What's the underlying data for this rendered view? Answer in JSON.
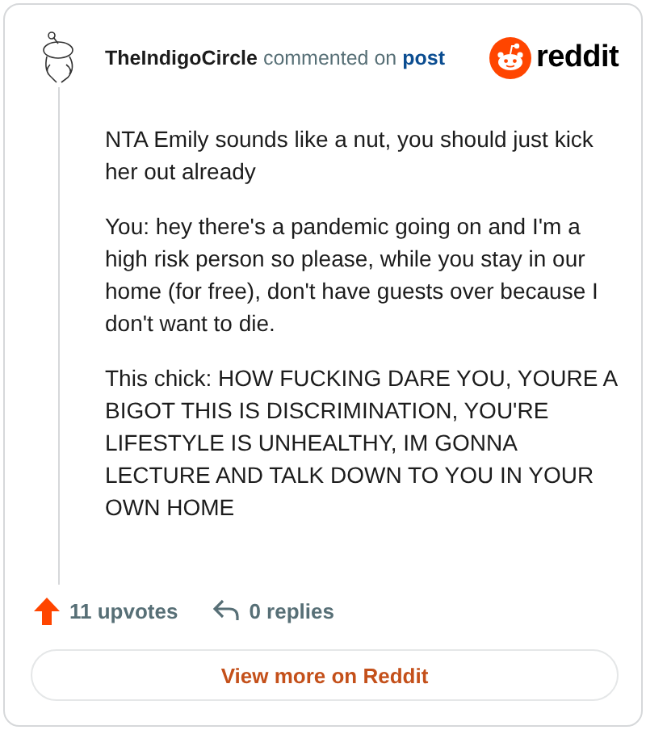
{
  "comment": {
    "author": "TheIndigoCircle",
    "action": "commented on",
    "link": "post"
  },
  "logo": {
    "wordmark": "reddit"
  },
  "paragraphs": [
    "NTA Emily sounds like a nut, you should just kick her out already",
    "You: hey there's a pandemic going on and I'm a high risk person so please, while you stay in our home (for free), don't have guests over because I don't want to die.",
    "This chick: HOW FUCKING DARE YOU, YOURE A BIGOT THIS IS DISCRIMINATION, YOU'RE LIFESTYLE IS UNHEALTHY, IM GONNA LECTURE AND TALK DOWN TO YOU IN YOUR OWN HOME"
  ],
  "stats": {
    "upvotes": "11 upvotes",
    "replies": "0 replies"
  },
  "button": "View more on Reddit"
}
